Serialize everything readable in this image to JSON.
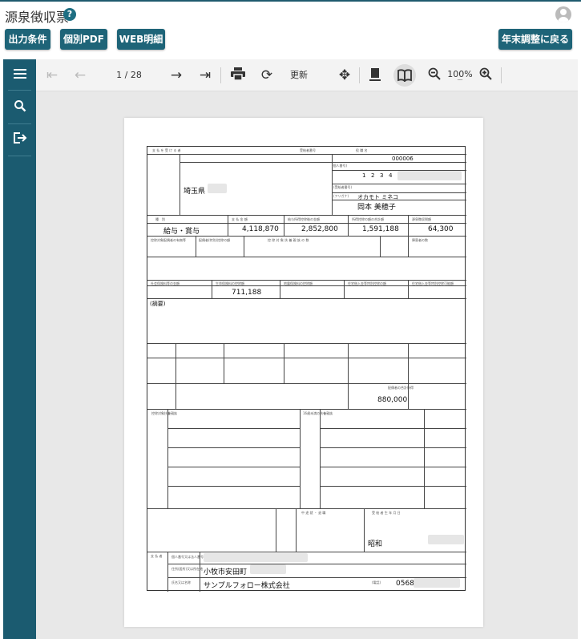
{
  "header": {
    "title": "源泉徴収票",
    "help_icon": "?"
  },
  "toolbar_buttons": {
    "output": "出力条件",
    "pdf": "個別PDF",
    "web": "WEB明細",
    "back": "年末調整に戻る"
  },
  "viewer": {
    "page_indicator": "1 / 28",
    "refresh_label": "更新",
    "zoom": "100%",
    "zoom_sub": "---"
  },
  "colors": {
    "brand": "#1e6478",
    "sidebar": "#1b5b70"
  },
  "form": {
    "recipient_no": "000006",
    "personal_no_digits": [
      "1",
      "2",
      "3",
      "4"
    ],
    "address": "埼玉県",
    "name_kana": "オカモト ミネコ",
    "name": "岡本 美穂子",
    "category": "給与・賞与",
    "payment_amount": "4,118,870",
    "after_deduction": "2,852,800",
    "total_deduction": "1,591,188",
    "withholding_tax": "64,300",
    "social_insurance": "711,188",
    "remarks_label": "(摘要)",
    "spouse_income": "880,000",
    "era": "昭和",
    "payer_address": "小牧市安田町",
    "payer_name": "サンプルフォロー株式会社",
    "payer_phone": "0568"
  }
}
